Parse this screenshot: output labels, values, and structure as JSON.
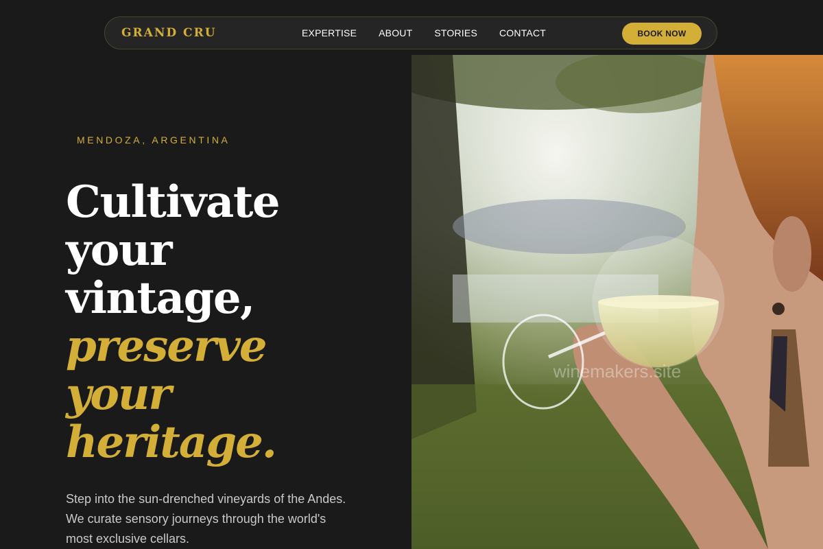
{
  "nav": {
    "brand": "GRAND CRU",
    "links": [
      "EXPERTISE",
      "ABOUT",
      "STORIES",
      "CONTACT"
    ],
    "cta": "BOOK NOW"
  },
  "hero": {
    "eyebrow": "MENDOZA, ARGENTINA",
    "headline": [
      "Cultivate",
      "your",
      "vintage,"
    ],
    "headline_accent": [
      "preserve",
      "your",
      "heritage."
    ],
    "lead": "Step into the sun-drenched vineyards of the Andes. We curate sensory journeys through the world's most exclusive cellars."
  },
  "photo": {
    "watermark": "winemakers.site"
  },
  "colors": {
    "background": "#1a1a1a",
    "accent": "#d4af37",
    "text": "#ffffff",
    "muted": "#c9c9c9"
  }
}
